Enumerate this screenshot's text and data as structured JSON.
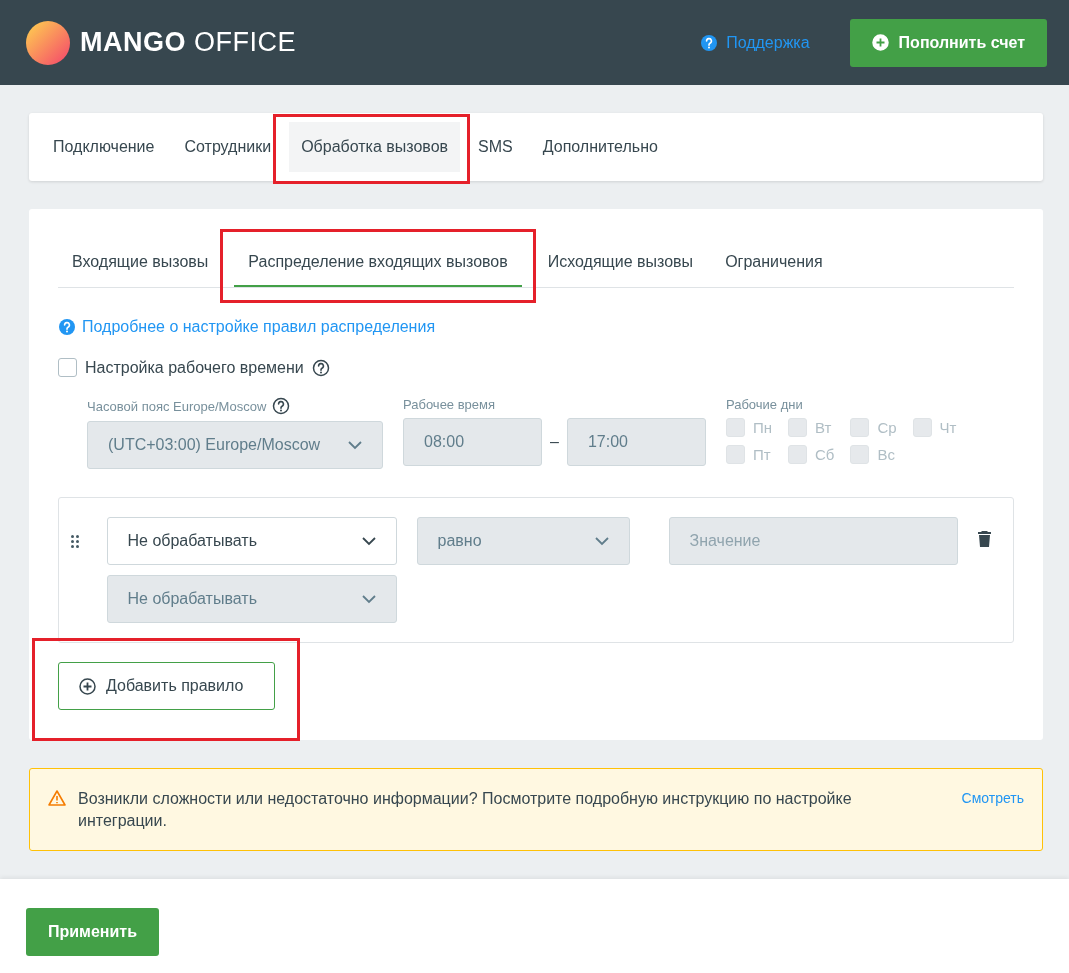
{
  "header": {
    "logo_bold": "MANGO",
    "logo_light": "OFFICE",
    "support_link": "Поддержка",
    "topup_button": "Пополнить счет"
  },
  "main_tabs": [
    {
      "label": "Подключение",
      "selected": false,
      "highlighted": false
    },
    {
      "label": "Сотрудники",
      "selected": false,
      "highlighted": false
    },
    {
      "label": "Обработка вызовов",
      "selected": true,
      "highlighted": true
    },
    {
      "label": "SMS",
      "selected": false,
      "highlighted": false
    },
    {
      "label": "Дополнительно",
      "selected": false,
      "highlighted": false
    }
  ],
  "sub_tabs": [
    {
      "label": "Входящие вызовы",
      "selected": false,
      "highlighted": false
    },
    {
      "label": "Распределение входящих вызовов",
      "selected": true,
      "highlighted": true
    },
    {
      "label": "Исходящие вызовы",
      "selected": false,
      "highlighted": false
    },
    {
      "label": "Ограничения",
      "selected": false,
      "highlighted": false
    }
  ],
  "help_link": "Подробнее о настройке правил распределения",
  "work_time": {
    "label": "Настройка рабочего времени",
    "checked": false,
    "timezone": {
      "label": "Часовой пояс Europe/Moscow",
      "value": "(UTC+03:00) Europe/Moscow",
      "disabled": true
    },
    "hours": {
      "label": "Рабочее время",
      "from": "08:00",
      "separator": "–",
      "to": "17:00",
      "disabled": true
    },
    "days": {
      "label": "Рабочие дни",
      "items": [
        {
          "label": "Пн",
          "checked": false
        },
        {
          "label": "Вт",
          "checked": false
        },
        {
          "label": "Ср",
          "checked": false
        },
        {
          "label": "Чт",
          "checked": false
        },
        {
          "label": "Пт",
          "checked": false
        },
        {
          "label": "Сб",
          "checked": false
        },
        {
          "label": "Вс",
          "checked": false
        }
      ],
      "disabled": true
    }
  },
  "rule": {
    "field": {
      "value": "Не обрабатывать",
      "disabled": false
    },
    "operator": {
      "value": "равно",
      "disabled": true
    },
    "value": {
      "placeholder": "Значение",
      "disabled": true
    },
    "action": {
      "value": "Не обрабатывать",
      "disabled": true
    }
  },
  "add_rule_button": {
    "label": "Добавить правило",
    "highlighted": true
  },
  "alert": {
    "text": "Возникли сложности или недостаточно информации? Посмотрите подробную инструкцию по настройке интеграции.",
    "link": "Смотреть"
  },
  "apply_button": "Применить"
}
